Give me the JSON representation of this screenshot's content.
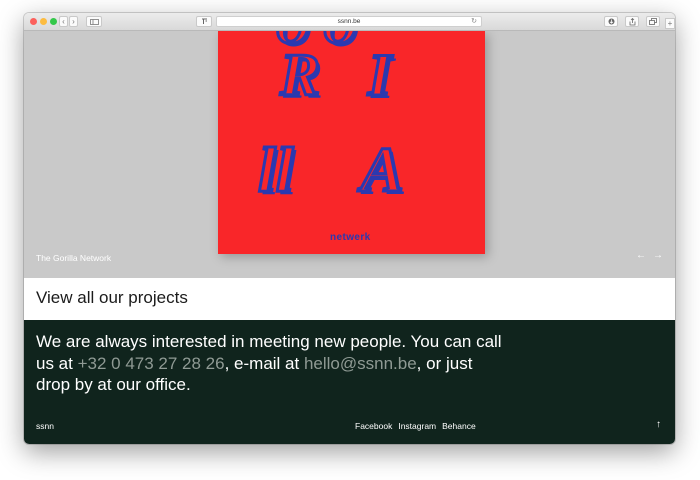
{
  "browser": {
    "url": "ssnn.be",
    "icons": {
      "back": "chevron-left-icon",
      "forward": "chevron-right-icon",
      "sidebar": "sidebar-icon",
      "extension": "extension-icon",
      "reload": "reload-icon",
      "downloads": "download-icon",
      "share": "share-icon",
      "tabs": "tabs-icon",
      "new_tab": "plus-icon"
    }
  },
  "hero": {
    "caption": "The Gorilla Network",
    "poster": {
      "letters_top": "OO",
      "letter_r": "R",
      "letter_i": "I",
      "letters_ll": "ll",
      "letter_a": "A",
      "word": "netwerk"
    },
    "prev_arrow": "←",
    "next_arrow": "→"
  },
  "projects_link": "View all our projects",
  "footer": {
    "text_1": "We are always interested in meeting new people. You can call us at ",
    "phone": "+32 0 473 27 28 26",
    "text_2": ", e-mail at ",
    "email": "hello@ssnn.be",
    "text_3": ", or just drop by at our office.",
    "brand": "ssnn",
    "links": [
      "Facebook",
      "Instagram",
      "Behance"
    ],
    "up_arrow": "↑"
  },
  "colors": {
    "hero_bg": "#c9c9c9",
    "poster_red": "#f92629",
    "poster_blue": "#2b39b0",
    "footer_bg": "#10241d",
    "muted_text": "#8f9a94"
  }
}
